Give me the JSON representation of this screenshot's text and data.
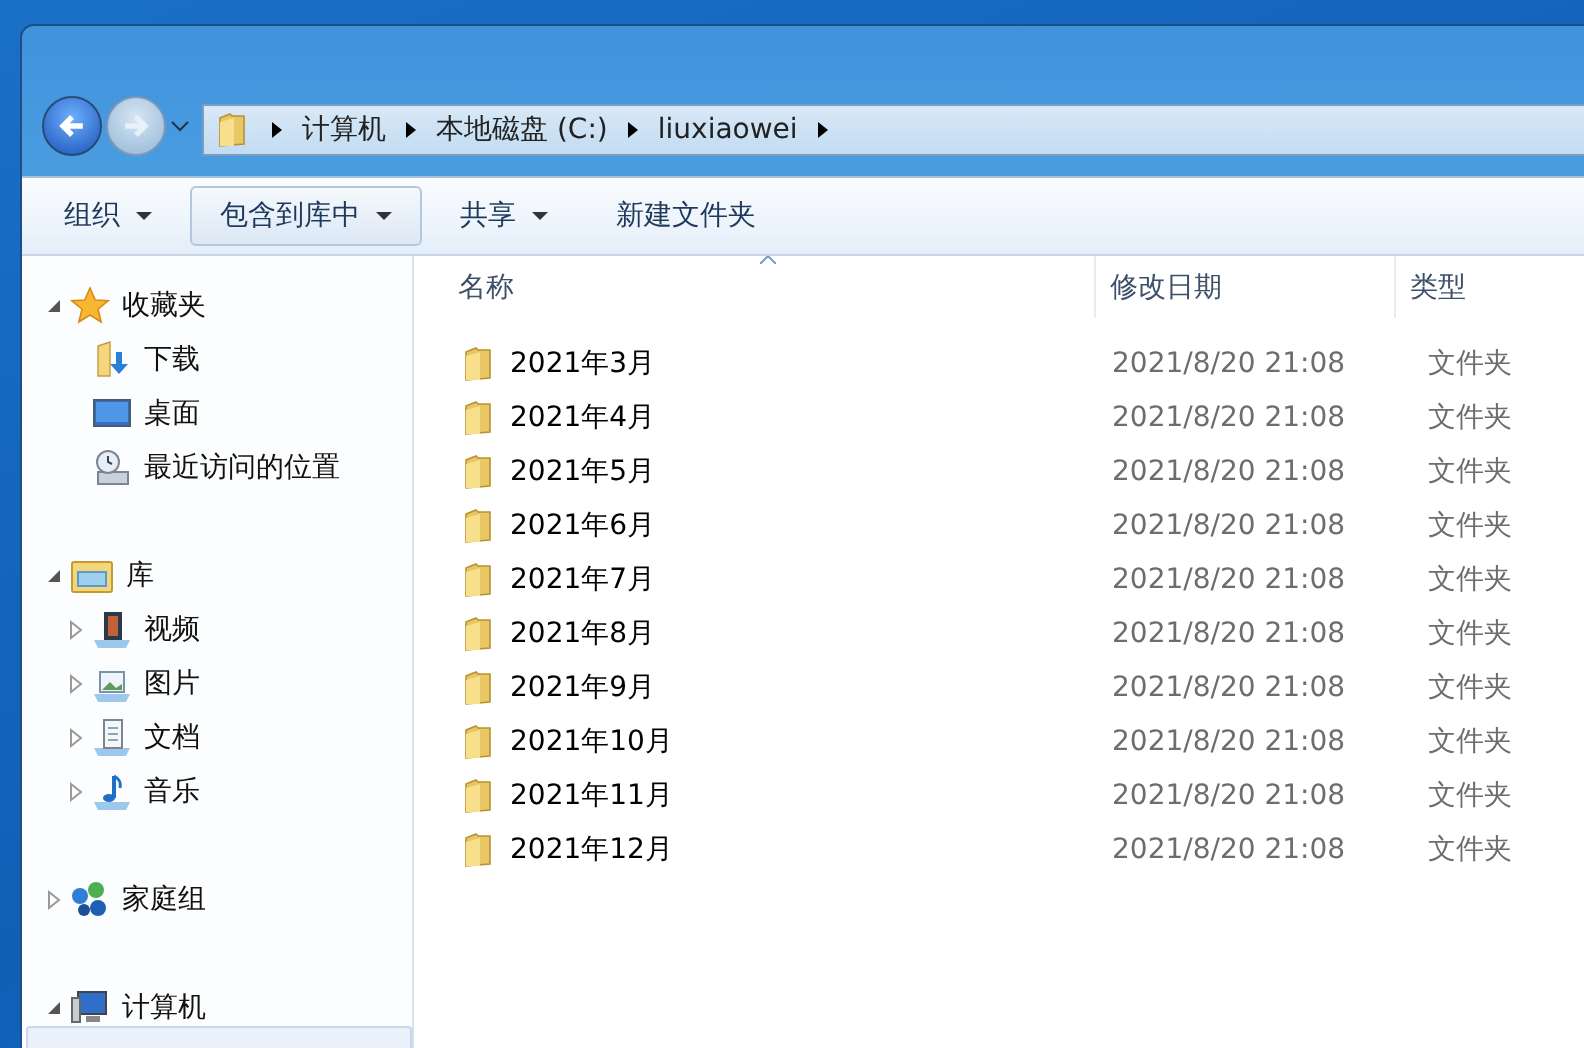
{
  "address_bar": {
    "segments": [
      "计算机",
      "本地磁盘 (C:)",
      "liuxiaowei"
    ]
  },
  "toolbar": [
    {
      "label": "组织",
      "dropdown": true,
      "selected": false
    },
    {
      "label": "包含到库中",
      "dropdown": true,
      "selected": true
    },
    {
      "label": "共享",
      "dropdown": true,
      "selected": false
    },
    {
      "label": "新建文件夹",
      "dropdown": false,
      "selected": false
    }
  ],
  "sidebar": {
    "groups": [
      {
        "label": "收藏夹",
        "kind": "favorites",
        "expanded": true,
        "children": [
          {
            "label": "下载",
            "kind": "downloads"
          },
          {
            "label": "桌面",
            "kind": "desktop"
          },
          {
            "label": "最近访问的位置",
            "kind": "recent"
          }
        ]
      },
      {
        "label": "库",
        "kind": "libraries",
        "expanded": true,
        "children": [
          {
            "label": "视频",
            "kind": "videos",
            "expanded": false
          },
          {
            "label": "图片",
            "kind": "pictures",
            "expanded": false
          },
          {
            "label": "文档",
            "kind": "documents",
            "expanded": false
          },
          {
            "label": "音乐",
            "kind": "music",
            "expanded": false
          }
        ]
      },
      {
        "label": "家庭组",
        "kind": "homegroup",
        "expanded": false
      },
      {
        "label": "计算机",
        "kind": "computer",
        "expanded": true
      }
    ]
  },
  "file_list": {
    "columns": [
      "名称",
      "修改日期",
      "类型"
    ],
    "rows": [
      {
        "name": "2021年3月",
        "modified": "2021/8/20 21:08",
        "type": "文件夹"
      },
      {
        "name": "2021年4月",
        "modified": "2021/8/20 21:08",
        "type": "文件夹"
      },
      {
        "name": "2021年5月",
        "modified": "2021/8/20 21:08",
        "type": "文件夹"
      },
      {
        "name": "2021年6月",
        "modified": "2021/8/20 21:08",
        "type": "文件夹"
      },
      {
        "name": "2021年7月",
        "modified": "2021/8/20 21:08",
        "type": "文件夹"
      },
      {
        "name": "2021年8月",
        "modified": "2021/8/20 21:08",
        "type": "文件夹"
      },
      {
        "name": "2021年9月",
        "modified": "2021/8/20 21:08",
        "type": "文件夹"
      },
      {
        "name": "2021年10月",
        "modified": "2021/8/20 21:08",
        "type": "文件夹"
      },
      {
        "name": "2021年11月",
        "modified": "2021/8/20 21:08",
        "type": "文件夹"
      },
      {
        "name": "2021年12月",
        "modified": "2021/8/20 21:08",
        "type": "文件夹"
      }
    ]
  }
}
